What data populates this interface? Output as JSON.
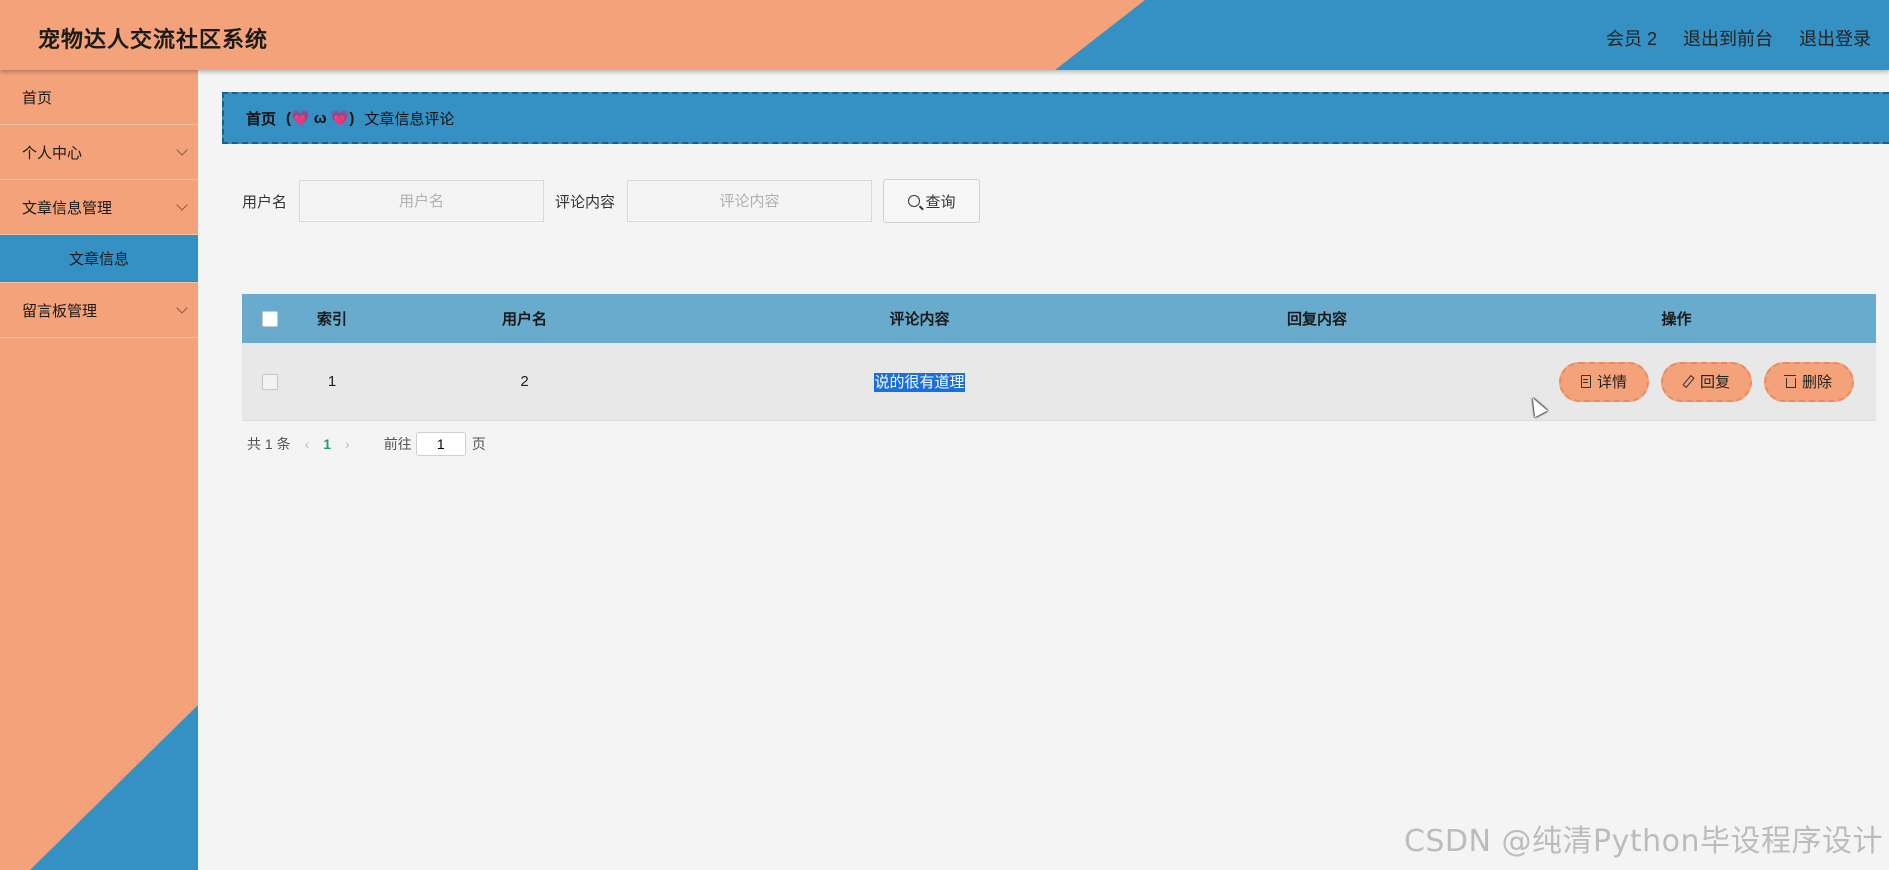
{
  "header": {
    "title": "宠物达人交流社区系统",
    "links": [
      "会员 2",
      "退出到前台",
      "退出登录"
    ]
  },
  "sidebar": {
    "items": [
      {
        "label": "首页",
        "expandable": false
      },
      {
        "label": "个人中心",
        "expandable": true
      },
      {
        "label": "文章信息管理",
        "expandable": true,
        "sub": "文章信息"
      },
      {
        "label": "留言板管理",
        "expandable": true
      }
    ]
  },
  "breadcrumb": {
    "home": "首页",
    "separator": "(💗 ω 💗)",
    "current": "文章信息评论"
  },
  "search": {
    "username_label": "用户名",
    "username_placeholder": "用户名",
    "comment_label": "评论内容",
    "comment_placeholder": "评论内容",
    "button": "查询"
  },
  "table": {
    "headers": [
      "索引",
      "用户名",
      "评论内容",
      "回复内容",
      "操作"
    ],
    "rows": [
      {
        "index": "1",
        "username": "2",
        "comment": "说的很有道理",
        "reply": ""
      }
    ],
    "actions": [
      "详情",
      "回复",
      "删除"
    ]
  },
  "pagination": {
    "total": "共 1 条",
    "current_page": "1",
    "goto_label": "前往",
    "goto_value": "1",
    "page_unit": "页"
  },
  "watermark": "CSDN @纯清Python毕设程序设计",
  "colors": {
    "primary_orange": "#f3a27a",
    "primary_blue": "#3590c4",
    "table_header": "#68abcd"
  }
}
